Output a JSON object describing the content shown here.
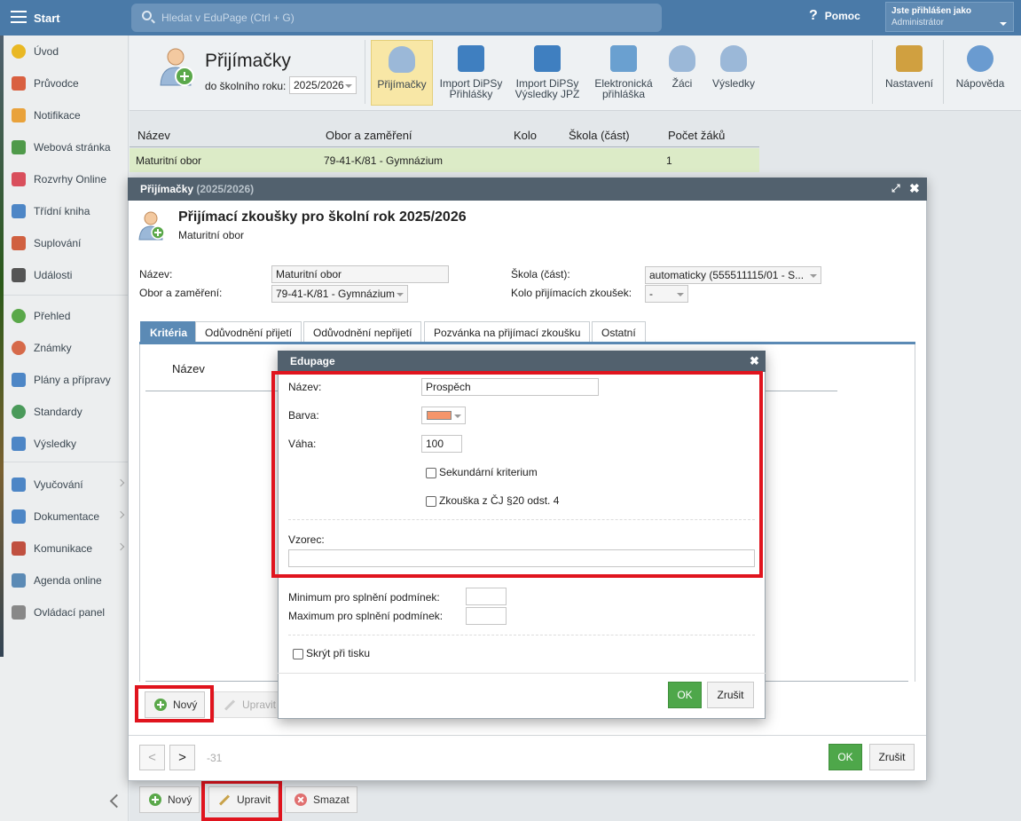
{
  "topbar": {
    "start": "Start",
    "search_placeholder": "Hledat v EduPage (Ctrl + G)",
    "help": "Pomoc",
    "user_title": "Jste přihlášen jako",
    "user_role": "Administrátor"
  },
  "sidebar": {
    "items": [
      "Úvod",
      "Průvodce",
      "Notifikace",
      "Webová stránka",
      "Rozvrhy Online",
      "Třídní kniha",
      "Suplování",
      "Události",
      "Přehled",
      "Známky",
      "Plány a přípravy",
      "Standardy",
      "Výsledky",
      "Vyučování",
      "Dokumentace",
      "Komunikace",
      "Agenda online",
      "Ovládací panel"
    ]
  },
  "toolbar": {
    "title": "Přijímačky",
    "year_label": "do školního roku:",
    "year_value": "2025/2026",
    "buttons": [
      "Přijímačky",
      "Import DiPSy Přihlášky",
      "Import DiPSy Výsledky JPZ",
      "Elektronická přihláška",
      "Žáci",
      "Výsledky",
      "Nastavení",
      "Nápověda"
    ]
  },
  "list": {
    "headers": [
      "Název",
      "Obor a zaměření",
      "Kolo",
      "Škola (část)",
      "Počet žáků"
    ],
    "row": [
      "Maturitní obor",
      "79-41-K/81 - Gymnázium",
      "",
      "",
      "1"
    ]
  },
  "bottom": {
    "new": "Nový",
    "edit": "Upravit",
    "delete": "Smazat"
  },
  "dialog1": {
    "title": "Přijímačky",
    "title_year": "(2025/2026)",
    "heading": "Přijímací zkoušky pro školní rok 2025/2026",
    "subheading": "Maturitní obor",
    "name_label": "Název:",
    "name_value": "Maturitní obor",
    "field_label": "Obor a zaměření:",
    "field_value": "79-41-K/81 - Gymnázium",
    "school_label": "Škola (část):",
    "school_value": "automaticky (555511115/01 - S...",
    "round_label": "Kolo přijímacích zkoušek:",
    "round_value": "-",
    "tabs": [
      "Kritéria",
      "Odůvodnění přijetí",
      "Odůvodnění nepřijetí",
      "Pozvánka na přijímací zkoušku",
      "Ostatní"
    ],
    "col_name": "Název",
    "new": "Nový",
    "edit": "Upravit",
    "prev": "<",
    "next": ">",
    "page_info": "-31",
    "ok": "OK",
    "cancel": "Zrušit"
  },
  "dialog2": {
    "title": "Edupage",
    "name_label": "Název:",
    "name_value": "Prospěch",
    "color_label": "Barva:",
    "color_value": "#f5956a",
    "weight_label": "Váha:",
    "weight_value": "100",
    "secondary": "Sekundární kriterium",
    "exam": "Zkouška z ČJ §20 odst. 4",
    "formula_label": "Vzorec:",
    "formula_value": "",
    "min_label": "Minimum pro splnění podmínek:",
    "max_label": "Maximum pro splnění podmínek:",
    "hide": "Skrýt při tisku",
    "ok": "OK",
    "cancel": "Zrušit"
  }
}
